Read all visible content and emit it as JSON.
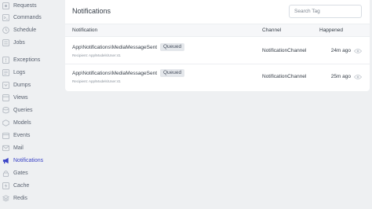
{
  "sidebar": {
    "items": [
      {
        "label": "Requests",
        "icon": "requests-icon",
        "active": false
      },
      {
        "label": "Commands",
        "icon": "commands-icon",
        "active": false
      },
      {
        "label": "Schedule",
        "icon": "schedule-icon",
        "active": false
      },
      {
        "label": "Jobs",
        "icon": "jobs-icon",
        "active": false
      },
      {
        "label": "Exceptions",
        "icon": "exceptions-icon",
        "active": false
      },
      {
        "label": "Logs",
        "icon": "logs-icon",
        "active": false
      },
      {
        "label": "Dumps",
        "icon": "dumps-icon",
        "active": false
      },
      {
        "label": "Views",
        "icon": "views-icon",
        "active": false
      },
      {
        "label": "Queries",
        "icon": "queries-icon",
        "active": false
      },
      {
        "label": "Models",
        "icon": "models-icon",
        "active": false
      },
      {
        "label": "Events",
        "icon": "events-icon",
        "active": false
      },
      {
        "label": "Mail",
        "icon": "mail-icon",
        "active": false
      },
      {
        "label": "Notifications",
        "icon": "megaphone-icon",
        "active": true
      },
      {
        "label": "Gates",
        "icon": "gates-icon",
        "active": false
      },
      {
        "label": "Cache",
        "icon": "cache-icon",
        "active": false
      },
      {
        "label": "Redis",
        "icon": "redis-icon",
        "active": false
      }
    ]
  },
  "panel": {
    "title": "Notifications",
    "search_placeholder": "Search Tag",
    "columns": {
      "notification": "Notification",
      "channel": "Channel",
      "happened": "Happened"
    },
    "rows": [
      {
        "title": "App\\Notifications\\MediaMessageSent",
        "status": "Queued",
        "recipient": "Recipient: App\\Models\\User:41",
        "channel": "NotificationChannel",
        "happened": "24m ago"
      },
      {
        "title": "App\\Notifications\\MediaMessageSent",
        "status": "Queued",
        "recipient": "Recipient: App\\Models\\User:41",
        "channel": "NotificationChannel",
        "happened": "25m ago"
      }
    ]
  },
  "colors": {
    "background": "#eef0f2",
    "panel": "#ffffff",
    "active_nav": "#3a43c6",
    "badge_bg": "#e4e7eb"
  }
}
